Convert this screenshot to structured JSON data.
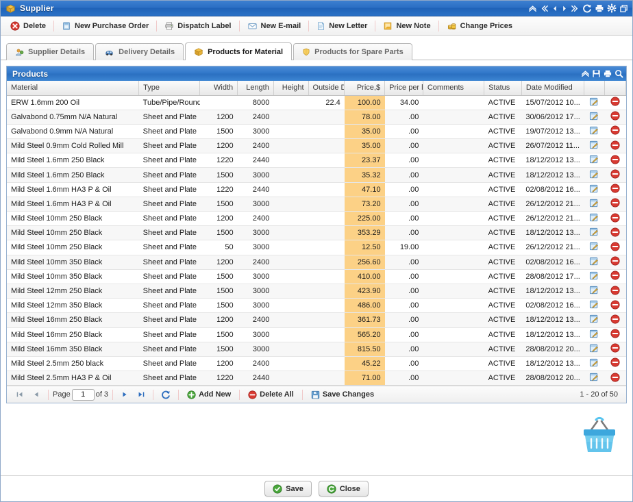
{
  "window": {
    "title": "Supplier",
    "title_icon": "package-icon",
    "controls": [
      {
        "name": "collapse-icon",
        "glyph": "»-up"
      },
      {
        "name": "first-record-icon",
        "glyph": "«"
      },
      {
        "name": "previous-record-icon",
        "glyph": "◀"
      },
      {
        "name": "next-record-icon",
        "glyph": "▶"
      },
      {
        "name": "last-record-icon",
        "glyph": "»"
      },
      {
        "name": "refresh-icon",
        "glyph": "↻"
      },
      {
        "name": "print-icon",
        "glyph": "print"
      },
      {
        "name": "settings-gear-icon",
        "glyph": "gear"
      },
      {
        "name": "restore-window-icon",
        "glyph": "restore"
      }
    ]
  },
  "toolbar": {
    "buttons": [
      {
        "name": "delete-button",
        "label": "Delete",
        "icon": "delete-x-icon"
      },
      {
        "name": "new-purchase-order-button",
        "label": "New Purchase Order",
        "icon": "document-blue-icon"
      },
      {
        "name": "dispatch-label-button",
        "label": "Dispatch Label",
        "icon": "printer-icon"
      },
      {
        "name": "new-email-button",
        "label": "New E-mail",
        "icon": "envelope-icon"
      },
      {
        "name": "new-letter-button",
        "label": "New Letter",
        "icon": "page-icon"
      },
      {
        "name": "new-note-button",
        "label": "New Note",
        "icon": "note-icon"
      },
      {
        "name": "change-prices-button",
        "label": "Change Prices",
        "icon": "coins-icon"
      }
    ]
  },
  "tabs": [
    {
      "name": "tab-supplier-details",
      "label": "Supplier Details",
      "icon": "user-icon",
      "active": false
    },
    {
      "name": "tab-delivery-details",
      "label": "Delivery Details",
      "icon": "truck-icon",
      "active": false
    },
    {
      "name": "tab-products-for-material",
      "label": "Products for Material",
      "icon": "box-icon",
      "active": true
    },
    {
      "name": "tab-products-for-spare-parts",
      "label": "Products for Spare Parts",
      "icon": "shield-icon",
      "active": false
    }
  ],
  "grid": {
    "title": "Products",
    "header_icons": [
      {
        "name": "collapse-icon"
      },
      {
        "name": "save-icon"
      },
      {
        "name": "print-icon"
      },
      {
        "name": "search-icon"
      }
    ],
    "columns": [
      {
        "key": "material",
        "label": "Material",
        "align": "left",
        "width": "190"
      },
      {
        "key": "type",
        "label": "Type",
        "align": "left",
        "width": "88"
      },
      {
        "key": "width",
        "label": "Width",
        "align": "right",
        "width": "54"
      },
      {
        "key": "length",
        "label": "Length",
        "align": "right",
        "width": "52"
      },
      {
        "key": "height",
        "label": "Height",
        "align": "right",
        "width": "50"
      },
      {
        "key": "outside_dia",
        "label": "Outside Dia",
        "align": "right",
        "width": "52"
      },
      {
        "key": "price",
        "label": "Price,$",
        "align": "right",
        "width": "58"
      },
      {
        "key": "price_per_length",
        "label": "Price per l",
        "align": "right",
        "width": "55"
      },
      {
        "key": "comments",
        "label": "Comments",
        "align": "left",
        "width": "88"
      },
      {
        "key": "status",
        "label": "Status",
        "align": "left",
        "width": "54"
      },
      {
        "key": "date_modified",
        "label": "Date Modified",
        "align": "left",
        "width": "90"
      },
      {
        "key": "edit",
        "label": "",
        "align": "center",
        "width": "30"
      },
      {
        "key": "remove",
        "label": "",
        "align": "center",
        "width": "30"
      }
    ],
    "rows": [
      {
        "material": "ERW 1.6mm 200 Oil",
        "type": "Tube/Pipe/Round",
        "width": "",
        "length": "8000",
        "height": "",
        "outside_dia": "22.4",
        "price": "100.00",
        "price_per_length": "34.00",
        "comments": "",
        "status": "ACTIVE",
        "date_modified": "15/07/2012 10..."
      },
      {
        "material": "Galvabond 0.75mm N/A Natural",
        "type": "Sheet and Plate",
        "width": "1200",
        "length": "2400",
        "height": "",
        "outside_dia": "",
        "price": "78.00",
        "price_per_length": ".00",
        "comments": "",
        "status": "ACTIVE",
        "date_modified": "30/06/2012 17..."
      },
      {
        "material": "Galvabond 0.9mm N/A Natural",
        "type": "Sheet and Plate",
        "width": "1500",
        "length": "3000",
        "height": "",
        "outside_dia": "",
        "price": "35.00",
        "price_per_length": ".00",
        "comments": "",
        "status": "ACTIVE",
        "date_modified": "19/07/2012 13..."
      },
      {
        "material": "Mild Steel 0.9mm Cold Rolled Mill",
        "type": "Sheet and Plate",
        "width": "1200",
        "length": "2400",
        "height": "",
        "outside_dia": "",
        "price": "35.00",
        "price_per_length": ".00",
        "comments": "",
        "status": "ACTIVE",
        "date_modified": "26/07/2012 11..."
      },
      {
        "material": "Mild Steel 1.6mm 250 Black",
        "type": "Sheet and Plate",
        "width": "1220",
        "length": "2440",
        "height": "",
        "outside_dia": "",
        "price": "23.37",
        "price_per_length": ".00",
        "comments": "",
        "status": "ACTIVE",
        "date_modified": "18/12/2012 13..."
      },
      {
        "material": "Mild Steel 1.6mm 250 Black",
        "type": "Sheet and Plate",
        "width": "1500",
        "length": "3000",
        "height": "",
        "outside_dia": "",
        "price": "35.32",
        "price_per_length": ".00",
        "comments": "",
        "status": "ACTIVE",
        "date_modified": "18/12/2012 13..."
      },
      {
        "material": "Mild Steel 1.6mm HA3 P & Oil",
        "type": "Sheet and Plate",
        "width": "1220",
        "length": "2440",
        "height": "",
        "outside_dia": "",
        "price": "47.10",
        "price_per_length": ".00",
        "comments": "",
        "status": "ACTIVE",
        "date_modified": "02/08/2012 16..."
      },
      {
        "material": "Mild Steel 1.6mm HA3 P & Oil",
        "type": "Sheet and Plate",
        "width": "1500",
        "length": "3000",
        "height": "",
        "outside_dia": "",
        "price": "73.20",
        "price_per_length": ".00",
        "comments": "",
        "status": "ACTIVE",
        "date_modified": "26/12/2012 21..."
      },
      {
        "material": "Mild Steel 10mm 250 Black",
        "type": "Sheet and Plate",
        "width": "1200",
        "length": "2400",
        "height": "",
        "outside_dia": "",
        "price": "225.00",
        "price_per_length": ".00",
        "comments": "",
        "status": "ACTIVE",
        "date_modified": "26/12/2012 21..."
      },
      {
        "material": "Mild Steel 10mm 250 Black",
        "type": "Sheet and Plate",
        "width": "1500",
        "length": "3000",
        "height": "",
        "outside_dia": "",
        "price": "353.29",
        "price_per_length": ".00",
        "comments": "",
        "status": "ACTIVE",
        "date_modified": "18/12/2012 13..."
      },
      {
        "material": "Mild Steel 10mm 250 Black",
        "type": "Sheet and Plate",
        "width": "50",
        "length": "3000",
        "height": "",
        "outside_dia": "",
        "price": "12.50",
        "price_per_length": "19.00",
        "comments": "",
        "status": "ACTIVE",
        "date_modified": "26/12/2012 21..."
      },
      {
        "material": "Mild Steel 10mm 350 Black",
        "type": "Sheet and Plate",
        "width": "1200",
        "length": "2400",
        "height": "",
        "outside_dia": "",
        "price": "256.60",
        "price_per_length": ".00",
        "comments": "",
        "status": "ACTIVE",
        "date_modified": "02/08/2012 16..."
      },
      {
        "material": "Mild Steel 10mm 350 Black",
        "type": "Sheet and Plate",
        "width": "1500",
        "length": "3000",
        "height": "",
        "outside_dia": "",
        "price": "410.00",
        "price_per_length": ".00",
        "comments": "",
        "status": "ACTIVE",
        "date_modified": "28/08/2012 17..."
      },
      {
        "material": "Mild Steel 12mm 250 Black",
        "type": "Sheet and Plate",
        "width": "1500",
        "length": "3000",
        "height": "",
        "outside_dia": "",
        "price": "423.90",
        "price_per_length": ".00",
        "comments": "",
        "status": "ACTIVE",
        "date_modified": "18/12/2012 13..."
      },
      {
        "material": "Mild Steel 12mm 350 Black",
        "type": "Sheet and Plate",
        "width": "1500",
        "length": "3000",
        "height": "",
        "outside_dia": "",
        "price": "486.00",
        "price_per_length": ".00",
        "comments": "",
        "status": "ACTIVE",
        "date_modified": "02/08/2012 16..."
      },
      {
        "material": "Mild Steel 16mm 250 Black",
        "type": "Sheet and Plate",
        "width": "1200",
        "length": "2400",
        "height": "",
        "outside_dia": "",
        "price": "361.73",
        "price_per_length": ".00",
        "comments": "",
        "status": "ACTIVE",
        "date_modified": "18/12/2012 13..."
      },
      {
        "material": "Mild Steel 16mm 250 Black",
        "type": "Sheet and Plate",
        "width": "1500",
        "length": "3000",
        "height": "",
        "outside_dia": "",
        "price": "565.20",
        "price_per_length": ".00",
        "comments": "",
        "status": "ACTIVE",
        "date_modified": "18/12/2012 13..."
      },
      {
        "material": "Mild Steel 16mm 350 Black",
        "type": "Sheet and Plate",
        "width": "1500",
        "length": "3000",
        "height": "",
        "outside_dia": "",
        "price": "815.50",
        "price_per_length": ".00",
        "comments": "",
        "status": "ACTIVE",
        "date_modified": "28/08/2012 20..."
      },
      {
        "material": "Mild Steel 2.5mm 250 black",
        "type": "Sheet and Plate",
        "width": "1200",
        "length": "2400",
        "height": "",
        "outside_dia": "",
        "price": "45.22",
        "price_per_length": ".00",
        "comments": "",
        "status": "ACTIVE",
        "date_modified": "18/12/2012 13..."
      },
      {
        "material": "Mild Steel 2.5mm HA3 P & Oil",
        "type": "Sheet and Plate",
        "width": "1220",
        "length": "2440",
        "height": "",
        "outside_dia": "",
        "price": "71.00",
        "price_per_length": ".00",
        "comments": "",
        "status": "ACTIVE",
        "date_modified": "28/08/2012 20..."
      }
    ]
  },
  "pager": {
    "first_label": "first-page",
    "prev_label": "previous-page",
    "page_label": "Page",
    "page_value": "1",
    "of_label": "of 3",
    "next_label": "next-page",
    "last_label": "last-page",
    "refresh_label": "refresh",
    "add_new_label": "Add New",
    "delete_all_label": "Delete All",
    "save_changes_label": "Save Changes",
    "record_count": "1 - 20 of 50"
  },
  "basket": {
    "name": "shopping-basket-icon"
  },
  "footer": {
    "save_label": "Save",
    "close_label": "Close"
  },
  "colors": {
    "titlebar_blue": "#2b6fc4",
    "price_highlight": "#fcd186",
    "accent_green": "#3f9e3f",
    "accent_red": "#cf3030"
  }
}
